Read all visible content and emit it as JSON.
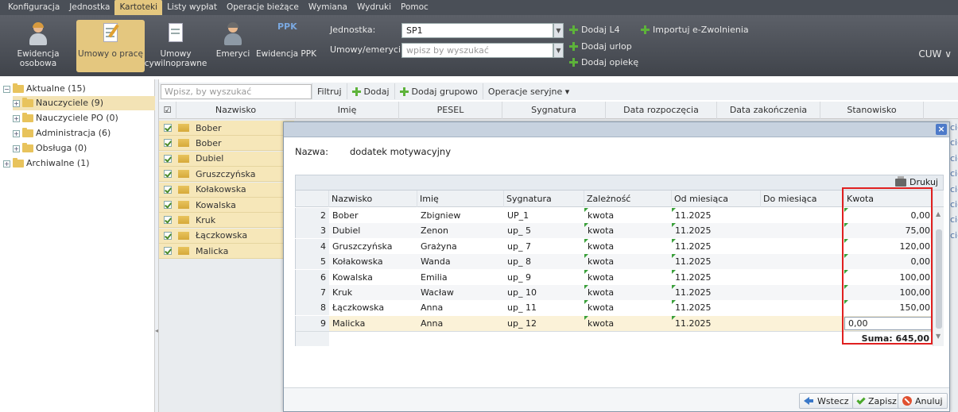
{
  "menu": [
    "Konfiguracja",
    "Jednostka",
    "Kartoteki",
    "Listy wypłat",
    "Operacje bieżące",
    "Wymiana",
    "Wydruki",
    "Pomoc"
  ],
  "menu_active": "Kartoteki",
  "ribbon": {
    "buttons": [
      "Ewidencja\nosobowa",
      "Umowy o pracę",
      "Umowy\ncywilnoprawne",
      "Emeryci",
      "Ewidencja PPK"
    ],
    "ppk_badge": "PPK",
    "jednostka_label": "Jednostka:",
    "jednostka_value": "SP1",
    "umowy_label": "Umowy/emeryci:",
    "umowy_placeholder": "wpisz by wyszukać",
    "actions": [
      "Dodaj L4",
      "Dodaj urlop",
      "Dodaj opiekę",
      "Importuj e-Zwolnienia"
    ],
    "cuw": "CUW ∨"
  },
  "tree": [
    {
      "label": "Aktualne (15)",
      "sign": "⊟"
    },
    {
      "label": "Nauczyciele (9)",
      "sign": "⊞"
    },
    {
      "label": "Nauczyciele PO (0)",
      "sign": "⊞"
    },
    {
      "label": "Administracja (6)",
      "sign": "⊞"
    },
    {
      "label": "Obsługa (0)",
      "sign": "⊞"
    },
    {
      "label": "Archiwalne (1)",
      "sign": "⊞"
    }
  ],
  "grid_toolbar": {
    "search_placeholder": "Wpisz, by wyszukać",
    "filter": "Filtruj",
    "add": "Dodaj",
    "add_group": "Dodaj grupowo",
    "serial_ops": "Operacje seryjne ▾"
  },
  "bg_columns": [
    "Nazwisko",
    "Imię",
    "PESEL",
    "Sygnatura",
    "Data rozpoczęcia",
    "Data zakończenia",
    "Stanowisko"
  ],
  "bg_rows": [
    "Bober",
    "Bober",
    "Dubiel",
    "Gruszczyńska",
    "Kołakowska",
    "Kowalska",
    "Kruk",
    "Łączkowska",
    "Malicka"
  ],
  "bg_right_cut": "cie",
  "modal": {
    "close": "×",
    "name_label": "Nazwa:",
    "name_value": "dodatek motywacyjny",
    "print": "Drukuj",
    "columns": [
      "Nazwisko",
      "Imię",
      "Sygnatura",
      "Zależność",
      "Od miesiąca",
      "Do miesiąca",
      "Kwota"
    ],
    "rows": [
      {
        "n": "2",
        "nazwisko": "Bober",
        "imie": "Zbigniew",
        "syg": "UP_1",
        "zal": "kwota",
        "od": "11.2025",
        "do": "",
        "kwota": "0,00"
      },
      {
        "n": "3",
        "nazwisko": "Dubiel",
        "imie": "Zenon",
        "syg": "up_ 5",
        "zal": "kwota",
        "od": "11.2025",
        "do": "",
        "kwota": "75,00"
      },
      {
        "n": "4",
        "nazwisko": "Gruszczyńska",
        "imie": "Grażyna",
        "syg": "up_ 7",
        "zal": "kwota",
        "od": "11.2025",
        "do": "",
        "kwota": "120,00"
      },
      {
        "n": "5",
        "nazwisko": "Kołakowska",
        "imie": "Wanda",
        "syg": "up_ 8",
        "zal": "kwota",
        "od": "11.2025",
        "do": "",
        "kwota": "0,00"
      },
      {
        "n": "6",
        "nazwisko": "Kowalska",
        "imie": "Emilia",
        "syg": "up_ 9",
        "zal": "kwota",
        "od": "11.2025",
        "do": "",
        "kwota": "100,00"
      },
      {
        "n": "7",
        "nazwisko": "Kruk",
        "imie": "Wacław",
        "syg": "up_ 10",
        "zal": "kwota",
        "od": "11.2025",
        "do": "",
        "kwota": "100,00"
      },
      {
        "n": "8",
        "nazwisko": "Łączkowska",
        "imie": "Anna",
        "syg": "up_ 11",
        "zal": "kwota",
        "od": "11.2025",
        "do": "",
        "kwota": "150,00"
      },
      {
        "n": "9",
        "nazwisko": "Malicka",
        "imie": "Anna",
        "syg": "up_ 12",
        "zal": "kwota",
        "od": "11.2025",
        "do": "",
        "kwota": "0,00"
      }
    ],
    "editing_value": "0,00",
    "sum": "Suma: 645,00",
    "buttons": {
      "back": "Wstecz",
      "save": "Zapisz",
      "cancel": "Anuluj"
    }
  },
  "colors": {
    "highlight": "#e02020",
    "active_tab": "#e4c77f",
    "row_selected": "#f6e7b9"
  }
}
